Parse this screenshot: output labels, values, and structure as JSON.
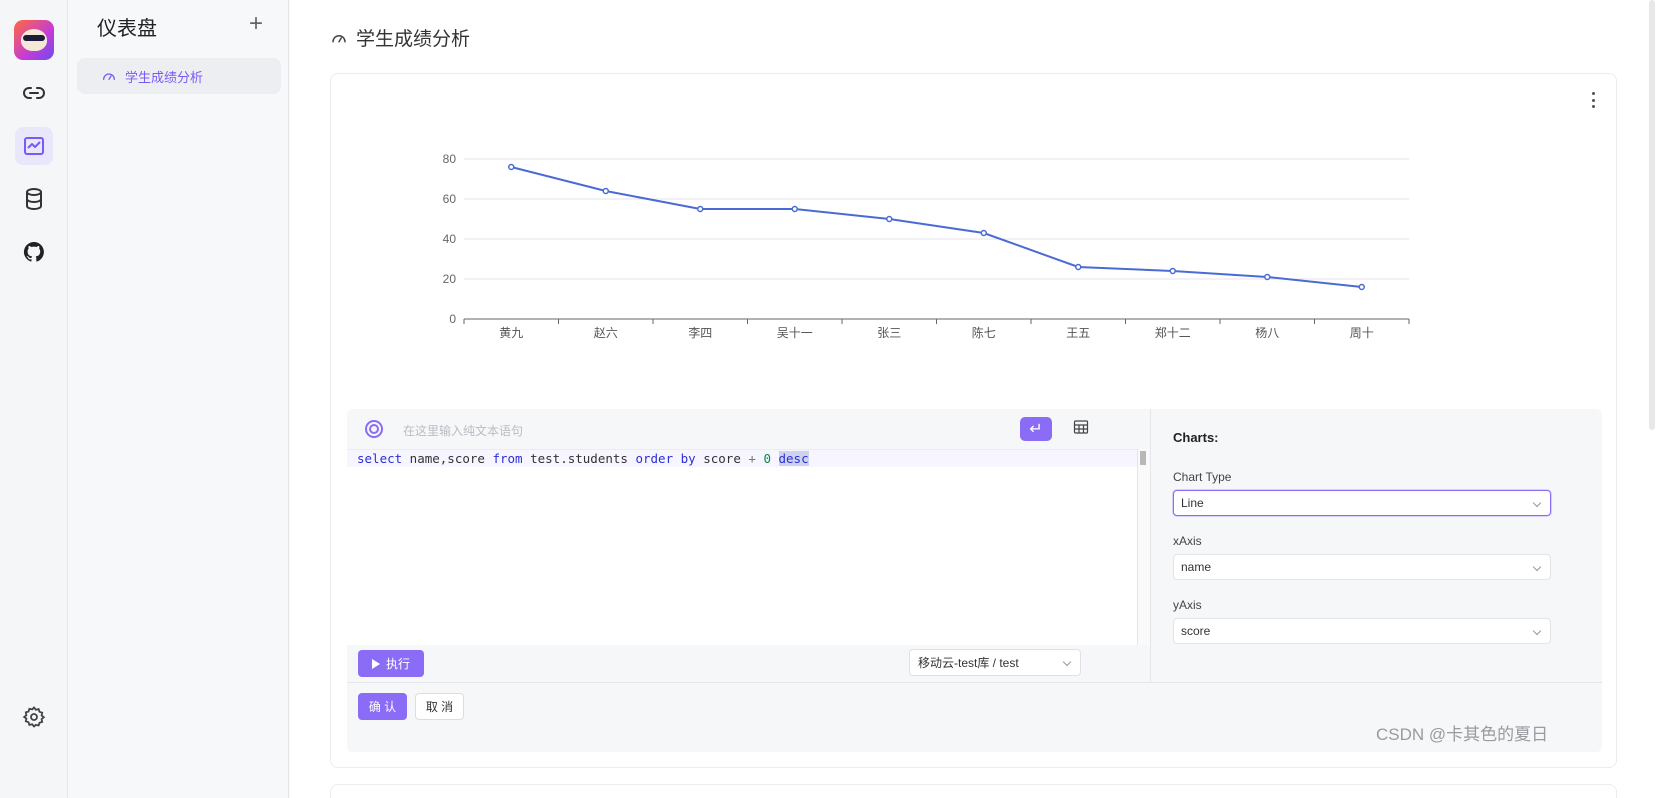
{
  "rail": {
    "items": [
      {
        "icon": "link-icon"
      },
      {
        "icon": "dashboard-chart-icon",
        "active": true
      },
      {
        "icon": "database-icon"
      },
      {
        "icon": "github-icon"
      }
    ],
    "bottom_icon": "gear-icon"
  },
  "sidebar": {
    "title": "仪表盘",
    "add_label": "+",
    "items": [
      {
        "label": "学生成绩分析",
        "icon": "gauge-icon"
      }
    ]
  },
  "page": {
    "title": "学生成绩分析"
  },
  "chart_data": {
    "type": "line",
    "categories": [
      "黄九",
      "赵六",
      "李四",
      "吴十一",
      "张三",
      "陈七",
      "王五",
      "郑十二",
      "杨八",
      "周十"
    ],
    "values": [
      76,
      64,
      55,
      55,
      50,
      43,
      26,
      24,
      21,
      16
    ],
    "ylim": [
      0,
      80
    ],
    "yticks": [
      0,
      20,
      40,
      60,
      80
    ],
    "grid": true,
    "color": "#4a6bd4"
  },
  "editor": {
    "placeholder": "在这里输入纯文本语句",
    "enter_icon": "↵",
    "table_icon": "table-icon",
    "sql": {
      "kw1": "select",
      "t1": " name,score ",
      "kw2": "from",
      "t2": " test.students ",
      "kw3": "order by",
      "t3": " score ",
      "op": "+",
      "sp": " ",
      "num": "0",
      "sp2": " ",
      "kw4": "desc"
    },
    "run_label": "执行",
    "datasource": "移动云-test库 / test"
  },
  "config": {
    "title": "Charts:",
    "chart_type_label": "Chart Type",
    "chart_type_value": "Line",
    "xaxis_label": "xAxis",
    "xaxis_value": "name",
    "yaxis_label": "yAxis",
    "yaxis_value": "score"
  },
  "actions": {
    "confirm": "确 认",
    "cancel": "取 消"
  },
  "watermark": "CSDN @卡其色的夏日"
}
